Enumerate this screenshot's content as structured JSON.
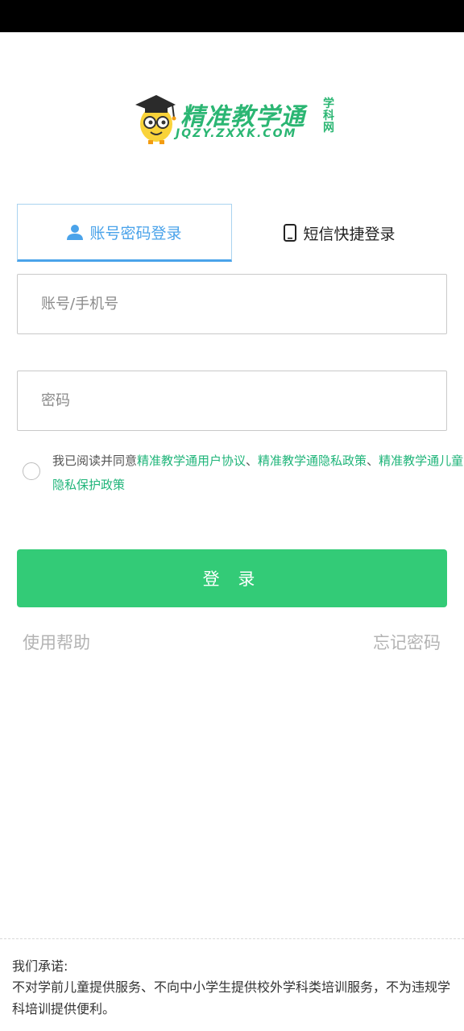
{
  "logo": {
    "title": "精准教学通",
    "subtitle": "JQZY.ZXXK.COM",
    "side_text": "学科网"
  },
  "tabs": [
    {
      "label": "账号密码登录",
      "icon": "user-icon",
      "active": true
    },
    {
      "label": "短信快捷登录",
      "icon": "phone-icon",
      "active": false
    }
  ],
  "form": {
    "account_placeholder": "账号/手机号",
    "account_value": "",
    "password_placeholder": "密码",
    "password_value": ""
  },
  "agreement": {
    "checked": false,
    "prefix": "我已阅读并同意",
    "link1": "精准教学通用户协议",
    "sep1": "、",
    "link2": "精准教学通隐私政策",
    "sep2": "、",
    "link3": "精准教学通儿童隐私保护政策"
  },
  "buttons": {
    "login": "登 录",
    "help": "使用帮助",
    "forgot": "忘记密码"
  },
  "footer": {
    "title": "我们承诺:",
    "text": "不对学前儿童提供服务、不向中小学生提供校外学科类培训服务，不为违规学科培训提供便利。"
  },
  "colors": {
    "accent_blue": "#4aa3ea",
    "primary_green": "#33cb77",
    "link_green": "#20b57a",
    "status_bar": "#000000"
  }
}
